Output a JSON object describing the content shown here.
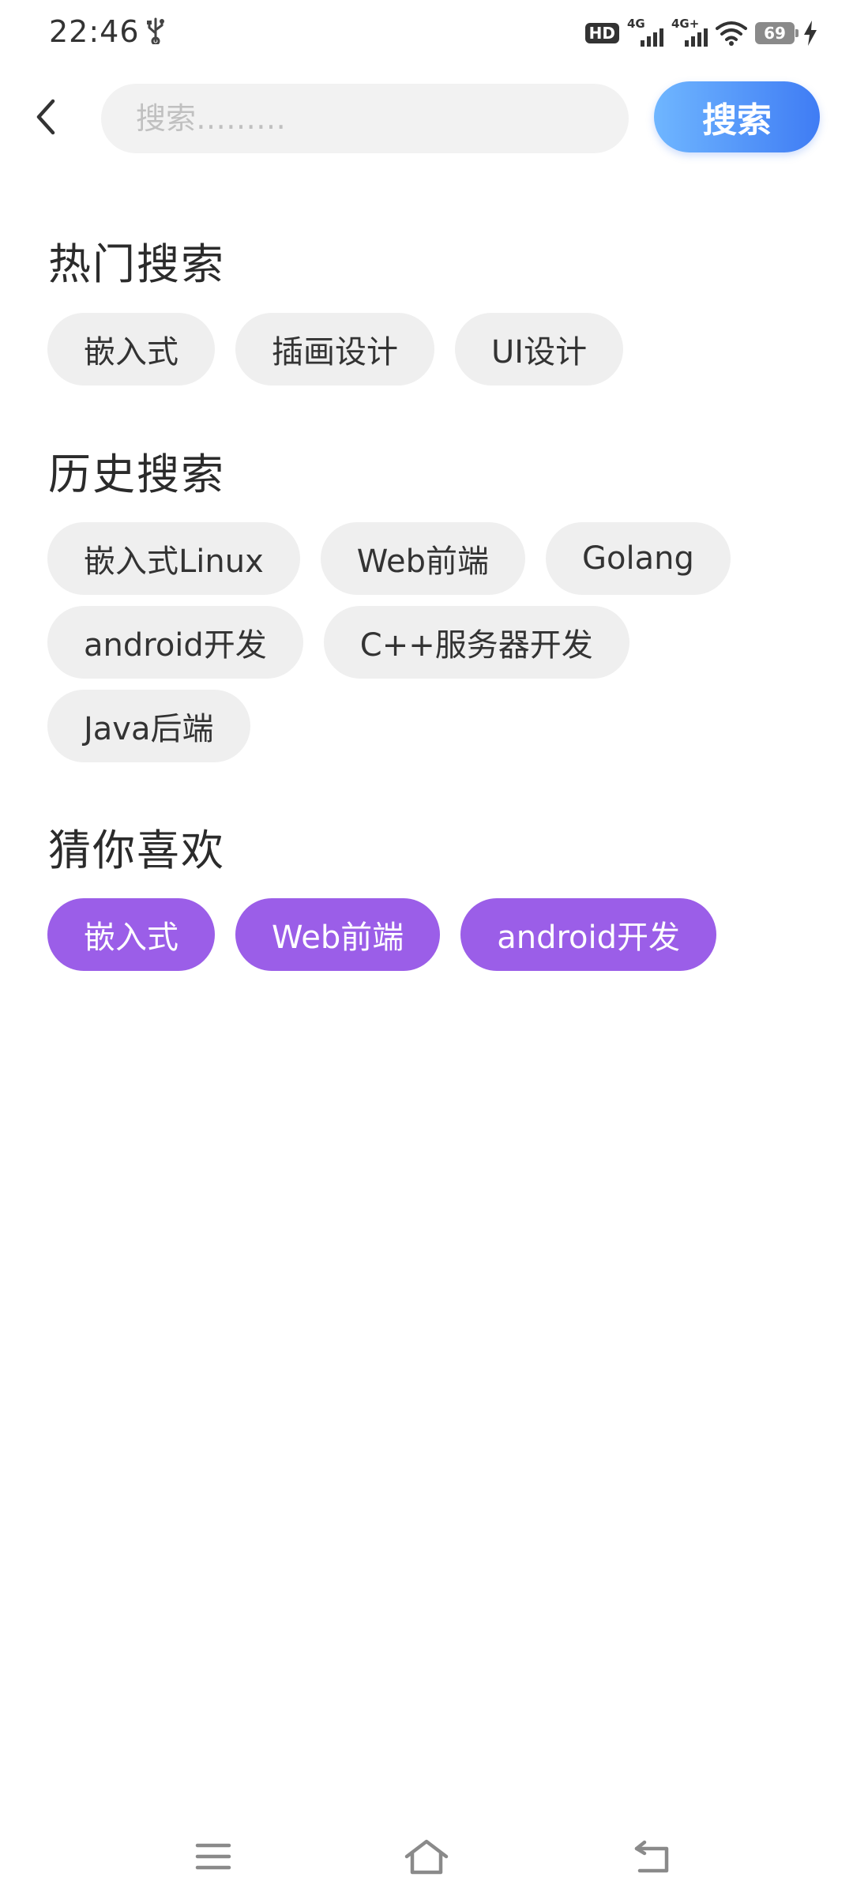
{
  "status_bar": {
    "time": "22:46",
    "hd_label": "HD",
    "signal1_label": "4G",
    "signal2_label": "4G+",
    "battery": "69"
  },
  "search": {
    "placeholder": "搜索………",
    "value": "",
    "button_label": "搜索"
  },
  "sections": {
    "hot": {
      "title": "热门搜索",
      "tags": [
        "嵌入式",
        "插画设计",
        "UI设计"
      ]
    },
    "history": {
      "title": "历史搜索",
      "tags": [
        "嵌入式Linux",
        "Web前端",
        "Golang",
        "android开发",
        "C++服务器开发",
        "Java后端"
      ]
    },
    "guess": {
      "title": "猜你喜欢",
      "tags": [
        "嵌入式",
        "Web前端",
        "android开发"
      ]
    }
  },
  "colors": {
    "accent_purple": "#9b5ee8",
    "search_button_start": "#6fb6ff",
    "search_button_end": "#3f7cf4",
    "chip_gray": "#efefef"
  },
  "icons": {
    "back": "chevron-left-icon",
    "nav_menu": "menu-icon",
    "nav_home": "home-icon",
    "nav_back": "back-icon"
  }
}
